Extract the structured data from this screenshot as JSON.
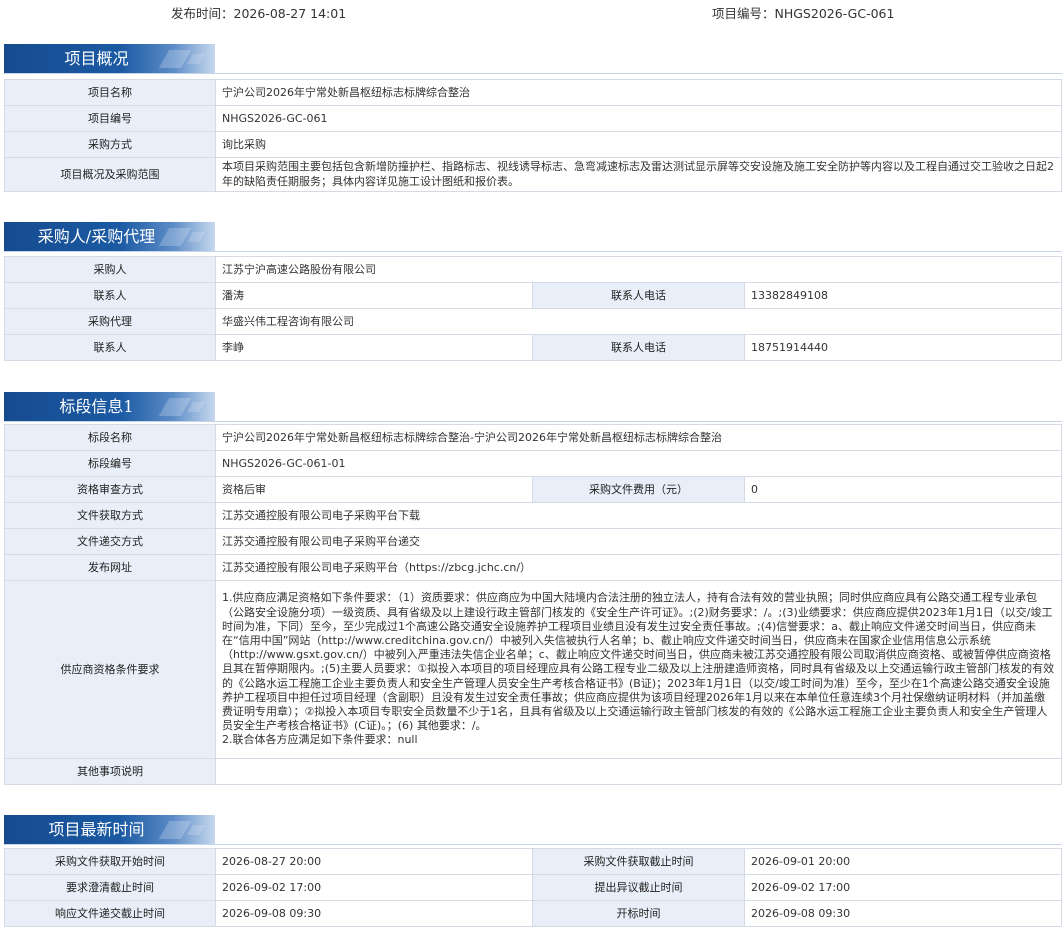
{
  "header": {
    "publish_time": "发布时间：2026-08-27 14:01",
    "project_no": "项目编号：NHGS2026-GC-061"
  },
  "overview": {
    "title": "项目概况",
    "name_label": "项目名称",
    "name_value": "宁沪公司2026年宁常处新昌枢纽标志标牌综合整治",
    "no_label": "项目编号",
    "no_value": "NHGS2026-GC-061",
    "method_label": "采购方式",
    "method_value": "询比采购",
    "scope_label": "项目概况及采购范围",
    "scope_value": "本项目采购范围主要包括包含新增防撞护栏、指路标志、视线诱导标志、急弯减速标志及雷达测试显示屏等交安设施及施工安全防护等内容以及工程自通过交工验收之日起2年的缺陷责任期服务；具体内容详见施工设计图纸和报价表。"
  },
  "purchaser": {
    "title": "采购人/采购代理",
    "purchaser_label": "采购人",
    "purchaser_value": "江苏宁沪高速公路股份有限公司",
    "contact_label": "联系人",
    "contact_value": "潘涛",
    "phone_label": "联系人电话",
    "phone_value": "13382849108",
    "agent_label": "采购代理",
    "agent_value": "华盛兴伟工程咨询有限公司",
    "agent_contact_label": "联系人",
    "agent_contact_value": "李峥",
    "agent_phone_label": "联系人电话",
    "agent_phone_value": "18751914440"
  },
  "lot": {
    "title": "标段信息1",
    "name_label": "标段名称",
    "name_value": "宁沪公司2026年宁常处新昌枢纽标志标牌综合整治-宁沪公司2026年宁常处新昌枢纽标志标牌综合整治",
    "no_label": "标段编号",
    "no_value": "NHGS2026-GC-061-01",
    "review_label": "资格审查方式",
    "review_value": "资格后审",
    "fee_label": "采购文件费用（元）",
    "fee_value": "0",
    "obtain_label": "文件获取方式",
    "obtain_value": "江苏交通控股有限公司电子采购平台下载",
    "submit_label": "文件递交方式",
    "submit_value": "江苏交通控股有限公司电子采购平台递交",
    "url_label": "发布网址",
    "url_value": "江苏交通控股有限公司电子采购平台（https://zbcg.jchc.cn/）",
    "qual_label": "供应商资格条件要求",
    "qual_value": "1.供应商应满足资格如下条件要求：（1）资质要求：供应商应为中国大陆境内合法注册的独立法人，持有合法有效的营业执照；同时供应商应具有公路交通工程专业承包（公路安全设施分项）一级资质、具有省级及以上建设行政主管部门核发的《安全生产许可证》。;(2)财务要求：/。;(3)业绩要求：供应商应提供2023年1月1日（以交/竣工时间为准，下同）至今，至少完成过1个高速公路交通安全设施养护工程项目业绩且没有发生过安全责任事故。;(4)信誉要求：a、截止响应文件递交时间当日，供应商未在“信用中国”网站（http://www.creditchina.gov.cn/）中被列入失信被执行人名单；b、截止响应文件递交时间当日，供应商未在国家企业信用信息公示系统（http://www.gsxt.gov.cn/）中被列入严重违法失信企业名单；c、截止响应文件递交时间当日，供应商未被江苏交通控股有限公司取消供应商资格、或被暂停供应商资格且其在暂停期限内。;(5)主要人员要求：①拟投入本项目的项目经理应具有公路工程专业二级及以上注册建造师资格，同时具有省级及以上交通运输行政主管部门核发的有效的《公路水运工程施工企业主要负责人和安全生产管理人员安全生产考核合格证书》(B证)；2023年1月1日（以交/竣工时间为准）至今，至少在1个高速公路交通安全设施养护工程项目中担任过项目经理（含副职）且没有发生过安全责任事故；供应商应提供为该项目经理2026年1月以来在本单位任意连续3个月社保缴纳证明材料（并加盖缴费证明专用章）；②拟投入本项目专职安全员数量不少于1名，且具有省级及以上交通运输行政主管部门核发的有效的《公路水运工程施工企业主要负责人和安全生产管理人员安全生产考核合格证书》(C证)。；(6) 其他要求：/。",
    "qual_value2": "2.联合体各方应满足如下条件要求：null",
    "other_label": "其他事项说明",
    "other_value": ""
  },
  "times": {
    "title": "项目最新时间",
    "get_start_label": "采购文件获取开始时间",
    "get_start_value": "2026-08-27 20:00",
    "get_end_label": "采购文件获取截止时间",
    "get_end_value": "2026-09-01 20:00",
    "clarify_label": "要求澄清截止时间",
    "clarify_value": "2026-09-02 17:00",
    "objection_label": "提出异议截止时间",
    "objection_value": "2026-09-02 17:00",
    "submit_end_label": "响应文件递交截止时间",
    "submit_end_value": "2026-09-08 09:30",
    "open_label": "开标时间",
    "open_value": "2026-09-08 09:30"
  }
}
